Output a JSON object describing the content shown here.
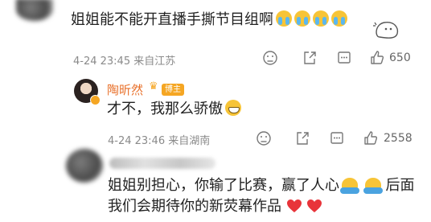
{
  "comment1": {
    "text": "姐姐能不能开直播手撕节目组啊",
    "emoji": "loudly-crying-emoji",
    "meta": "4-24 23:45 来自江苏",
    "like_count": "650"
  },
  "reply": {
    "author": "陶昕然",
    "badge": "博主",
    "text": "才不，我那么骄傲",
    "emoji": "grinning-emoji",
    "meta": "4-24 23:46 来自湖南",
    "like_count": "2558"
  },
  "comment2": {
    "line1_a": "姐姐别担心，你输了比赛，赢了人心",
    "line1_b": "后面",
    "line2": "我们会期待你的新荧幕作品",
    "emoji": "hugging-emoji"
  },
  "colors": {
    "text": "#222222",
    "meta": "#8a8a8a",
    "badge": "#f5a623",
    "heart": "#e8343a"
  }
}
